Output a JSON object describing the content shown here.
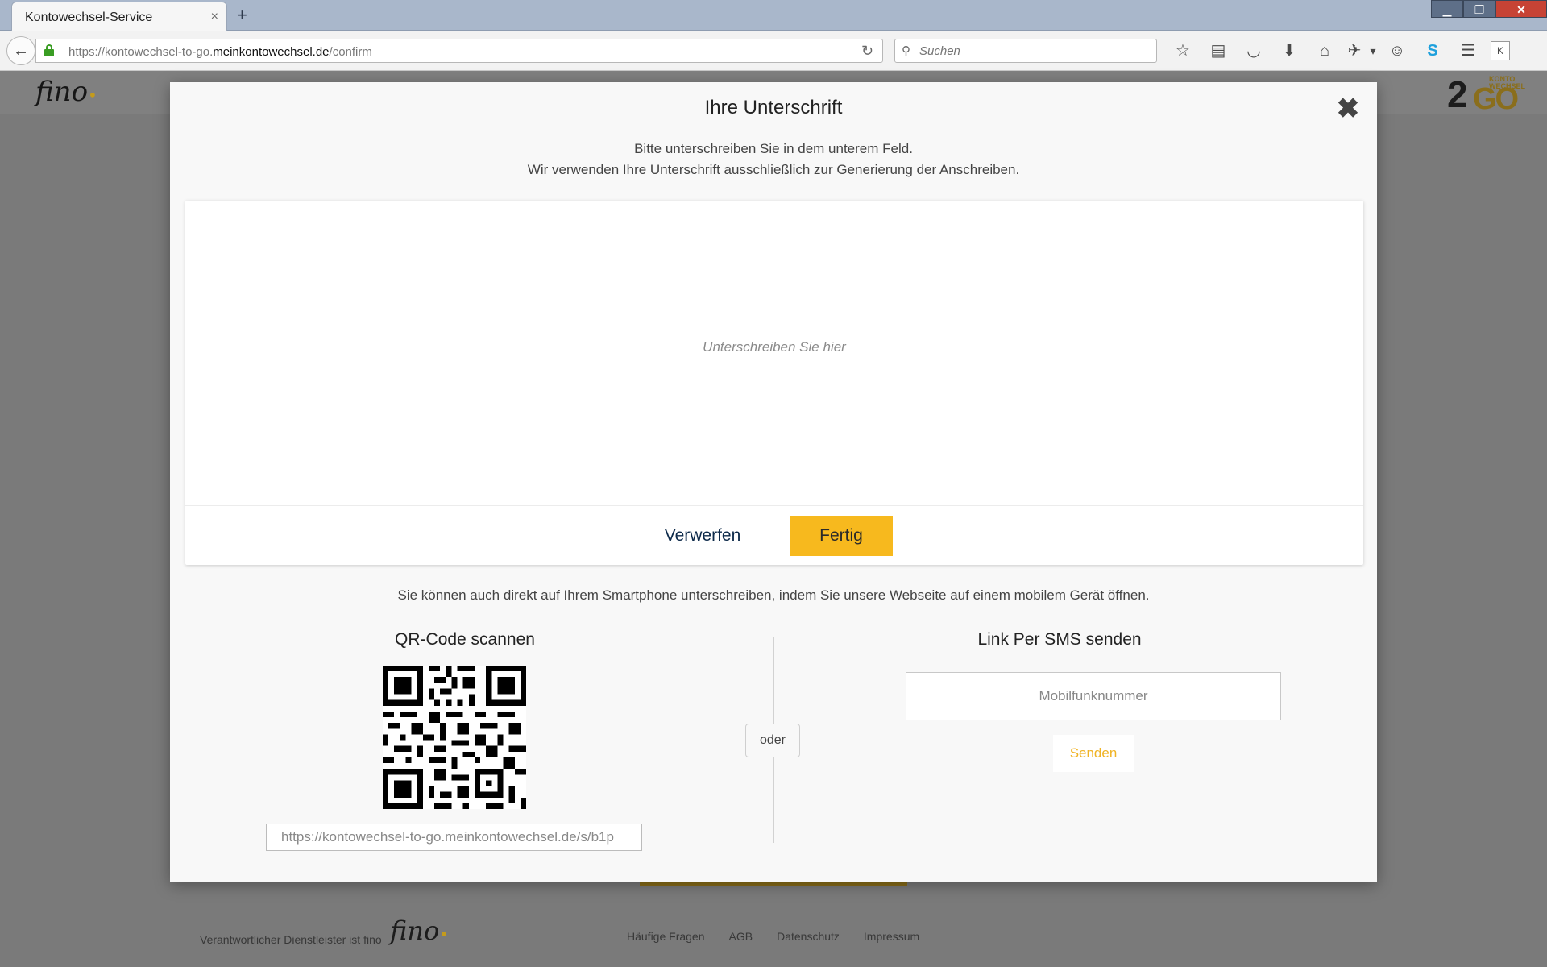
{
  "browser": {
    "tab_title": "Kontowechsel-Service",
    "tab_close": "×",
    "new_tab": "+",
    "window_controls": {
      "minimize": "▁",
      "restore": "❐",
      "close": "✕"
    },
    "back": "←",
    "url_prefix": "https://kontowechsel-to-go.",
    "url_domain": "meinkontowechsel.de",
    "url_path": "/confirm",
    "reload": "↻",
    "search_icon": "⚲",
    "search_placeholder": "Suchen",
    "toolbar_icons": [
      {
        "name": "bookmark-star-icon",
        "glyph": "☆"
      },
      {
        "name": "reader-list-icon",
        "glyph": "▤"
      },
      {
        "name": "pocket-icon",
        "glyph": "◡"
      },
      {
        "name": "download-icon",
        "glyph": "⬇"
      },
      {
        "name": "home-icon",
        "glyph": "⌂"
      },
      {
        "name": "addon-icon",
        "glyph": "✈"
      },
      {
        "name": "dropdown-icon",
        "glyph": "▾"
      },
      {
        "name": "chat-icon",
        "glyph": "☺"
      },
      {
        "name": "skype-icon",
        "glyph": "S"
      },
      {
        "name": "menu-icon",
        "glyph": "☰"
      },
      {
        "name": "extension-k-icon",
        "glyph": "K"
      }
    ]
  },
  "page": {
    "logo": "fino",
    "logo_dot": "•",
    "k2g_logo": {
      "num": "2",
      "gc": "GO",
      "text1": "KONTO",
      "text2": "WECHSEL"
    },
    "footer_text": "Verantwortlicher Dienstleister ist fino",
    "footer_logo": "fino",
    "footer_links": [
      "Häufige Fragen",
      "AGB",
      "Datenschutz",
      "Impressum"
    ]
  },
  "modal": {
    "title": "Ihre Unterschrift",
    "close": "✖",
    "instruction_line1": "Bitte unterschreiben Sie in dem unterem Feld.",
    "instruction_line2": "Wir verwenden Ihre Unterschrift ausschließlich zur Generierung der Anschreiben.",
    "signature_placeholder": "Unterschreiben Sie hier",
    "discard_label": "Verwerfen",
    "done_label": "Fertig",
    "mobile_text": "Sie können auch direkt auf Ihrem Smartphone unterschreiben, indem Sie unsere Webseite auf einem mobilem Gerät öffnen.",
    "qr_heading": "QR-Code scannen",
    "qr_url": "https://kontowechsel-to-go.meinkontowechsel.de/s/b1p",
    "or_label": "oder",
    "sms_heading": "Link Per SMS senden",
    "phone_placeholder": "Mobilfunknummer",
    "send_label": "Senden"
  },
  "colors": {
    "accent": "#f7b91e",
    "discard_text": "#0d2a4a",
    "send_text": "#f0b324",
    "overlay": "#7a7a7a"
  }
}
